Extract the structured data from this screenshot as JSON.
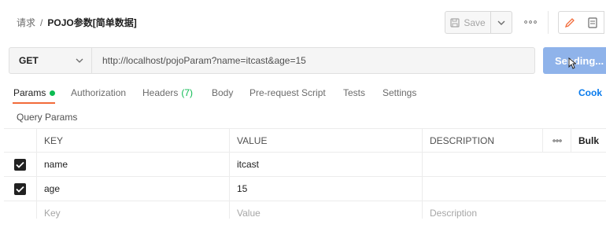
{
  "header": {
    "breadcrumb_parent": "请求",
    "breadcrumb_separator": "/",
    "breadcrumb_current": "POJO参数[简单数据]",
    "save_label": "Save"
  },
  "request": {
    "method": "GET",
    "url": "http://localhost/pojoParam?name=itcast&age=15",
    "send_label": "Sending..."
  },
  "tabs": [
    {
      "label": "Params",
      "dot": true
    },
    {
      "label": "Authorization"
    },
    {
      "label": "Headers",
      "count": "(7)"
    },
    {
      "label": "Body"
    },
    {
      "label": "Pre-request Script"
    },
    {
      "label": "Tests"
    },
    {
      "label": "Settings"
    }
  ],
  "cookies_label": "Cook",
  "section_label": "Query Params",
  "table": {
    "columns": {
      "key": "KEY",
      "value": "VALUE",
      "description": "DESCRIPTION",
      "bulk": "Bulk"
    },
    "rows": [
      {
        "key": "name",
        "value": "itcast",
        "description": "",
        "checked": true
      },
      {
        "key": "age",
        "value": "15",
        "description": "",
        "checked": true
      }
    ],
    "placeholders": {
      "key": "Key",
      "value": "Value",
      "description": "Description"
    }
  },
  "colors": {
    "accent": "#f26b3a",
    "send": "#8fb3ea",
    "dot": "#0cbb52",
    "link": "#097bed"
  },
  "icons": [
    "save-icon",
    "chevron-down-icon",
    "more-icon",
    "edit-icon",
    "document-icon",
    "cursor-icon",
    "check-icon"
  ]
}
